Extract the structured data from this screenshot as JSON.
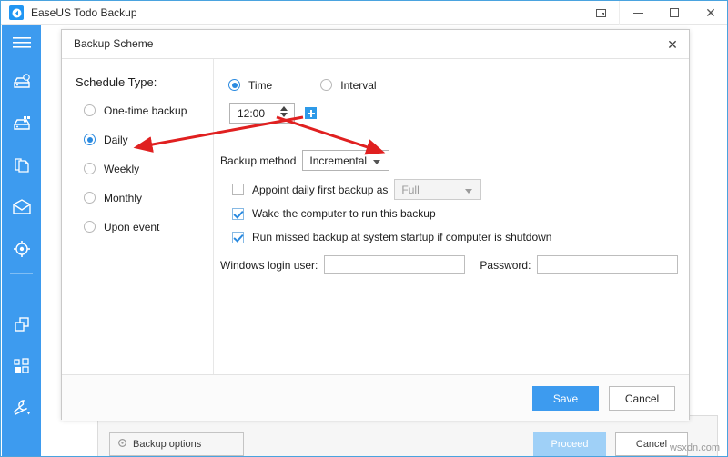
{
  "window": {
    "title": "EaseUS Todo Backup",
    "logo_icon": "easeus-logo-icon",
    "controls": {
      "restore_icon": "restore-down-icon",
      "minimize_icon": "minimize-icon",
      "maximize_icon": "maximize-icon",
      "close_icon": "close-icon"
    }
  },
  "sidebar": {
    "items": [
      {
        "icon": "hamburger-menu-icon",
        "name": "menu"
      },
      {
        "icon": "disk-backup-icon",
        "name": "disk-backup"
      },
      {
        "icon": "system-backup-icon",
        "name": "system-backup"
      },
      {
        "icon": "file-backup-icon",
        "name": "file-backup"
      },
      {
        "icon": "mail-backup-icon",
        "name": "mail-backup"
      },
      {
        "icon": "smart-backup-icon",
        "name": "smart-backup"
      },
      {
        "icon": "clone-icon",
        "name": "clone"
      },
      {
        "icon": "tools-grid-icon",
        "name": "tools"
      },
      {
        "icon": "wrench-icon",
        "name": "settings-wrench"
      }
    ]
  },
  "background_window": {
    "backup_options_label": "Backup options",
    "backup_options_icon": "gear-icon",
    "proceed_label": "Proceed",
    "cancel_label": "Cancel"
  },
  "dialog": {
    "title": "Backup Scheme",
    "close_icon": "close-icon",
    "schedule": {
      "label": "Schedule Type:",
      "options": [
        {
          "label": "One-time backup",
          "selected": false
        },
        {
          "label": "Daily",
          "selected": true
        },
        {
          "label": "Weekly",
          "selected": false
        },
        {
          "label": "Monthly",
          "selected": false
        },
        {
          "label": "Upon event",
          "selected": false
        }
      ]
    },
    "mode": {
      "time_label": "Time",
      "time_selected": true,
      "interval_label": "Interval",
      "interval_selected": false
    },
    "time_field": {
      "value": "12:00",
      "spinner_icon": "spinner-up-down-icon",
      "add_icon": "plus-icon"
    },
    "backup_method": {
      "label": "Backup method",
      "value": "Incremental",
      "arrow_icon": "chevron-down-icon"
    },
    "appoint_first": {
      "label": "Appoint daily first backup as",
      "checked": false,
      "value": "Full",
      "disabled": true,
      "arrow_icon": "chevron-down-icon"
    },
    "wake_computer": {
      "label": "Wake the computer to run this backup",
      "checked": true
    },
    "run_missed": {
      "label": "Run missed backup at system startup if computer is shutdown",
      "checked": true
    },
    "credentials": {
      "user_label": "Windows login user:",
      "user_value": "",
      "password_label": "Password:",
      "password_value": ""
    },
    "footer": {
      "save_label": "Save",
      "cancel_label": "Cancel"
    }
  },
  "annotations": {
    "arrow_color": "#e02020",
    "arrow_to_weekly": "weekly-option",
    "arrow_to_backup_method": "backup-method-combo"
  },
  "watermark": {
    "text": "wsxdn.com"
  }
}
